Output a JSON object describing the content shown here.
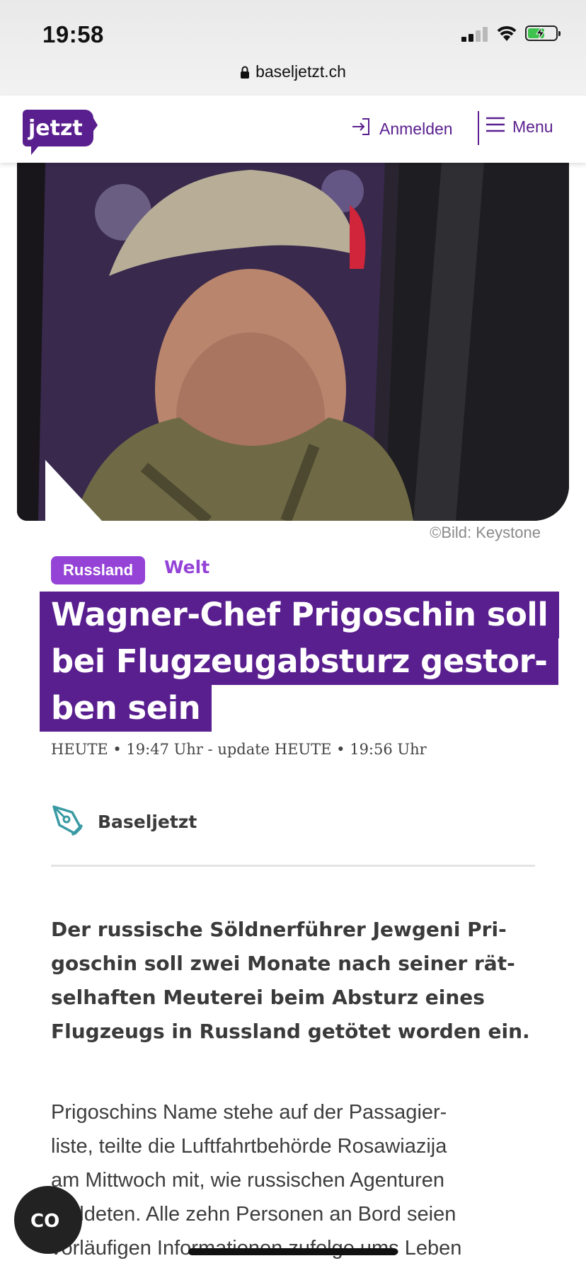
{
  "status_bar": {
    "time": "19:58",
    "url": "baseljetzt.ch",
    "battery_color": "#3dc24d"
  },
  "header": {
    "logo_text": "jetzt",
    "login_label": "Anmelden",
    "menu_label": "Menu",
    "brand_color": "#5a1f8f"
  },
  "hero": {
    "caption": "©Bild: Keystone"
  },
  "article": {
    "tag_primary": "Russland",
    "tag_secondary": "Welt",
    "headline_lines": [
      "Wagner-Chef Prigoschin soll",
      "bei Flugzeugabsturz gestor-",
      "ben sein"
    ],
    "meta": "HEUTE • 19:47 Uhr - update HEUTE • 19:56 Uhr",
    "author": "Baseljetzt",
    "lead_lines": [
      "Der russische Söldnerführer Jewgeni Pri-",
      "goschin soll zwei Monate nach seiner rät-",
      "selhaften Meuterei beim Absturz eines",
      "Flugzeugs in Russland getötet worden ein."
    ],
    "body_lines": [
      "Prigoschins Name stehe auf der Passagier-",
      "liste, teilte die Luftfahrtbehörde Rosawiazija",
      "am Mittwoch mit, wie russischen Agenturen",
      "meldeten. Alle zehn Personen an Bord seien",
      "vorläufigen Informationen zufolge ums Leben"
    ]
  },
  "floating_button": {
    "label": "CO"
  }
}
